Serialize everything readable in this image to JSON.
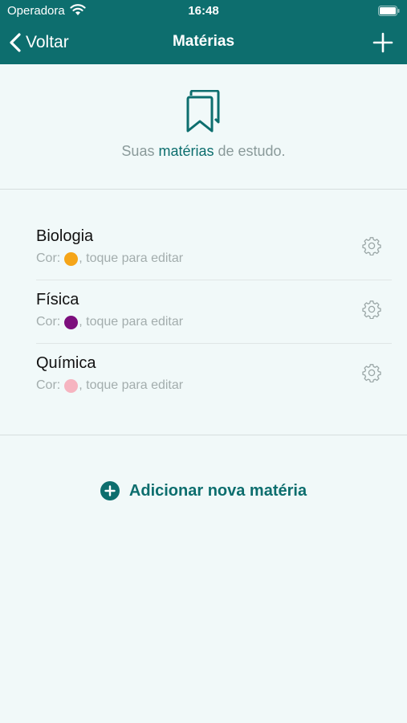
{
  "colors": {
    "accent": "#0d6e6e",
    "background": "#f1f9f9",
    "muted": "#a3adad"
  },
  "status_bar": {
    "carrier": "Operadora",
    "time": "16:48"
  },
  "nav": {
    "back_label": "Voltar",
    "title": "Matérias",
    "add_icon": "plus-icon"
  },
  "intro": {
    "icon": "bookmark-icon",
    "text_before": "Suas ",
    "text_highlight": "matérias",
    "text_after": " de estudo."
  },
  "subjects": [
    {
      "name": "Biologia",
      "color_label": "Cor:",
      "color": "#f5a519",
      "hint": ", toque para editar",
      "icon": "gear-icon"
    },
    {
      "name": "Física",
      "color_label": "Cor:",
      "color": "#7d0f7d",
      "hint": ", toque para editar",
      "icon": "gear-icon"
    },
    {
      "name": "Química",
      "color_label": "Cor:",
      "color": "#f6b4c0",
      "hint": ", toque para editar",
      "icon": "gear-icon"
    }
  ],
  "add_new": {
    "label": "Adicionar nova matéria",
    "icon": "plus-circle-icon"
  }
}
